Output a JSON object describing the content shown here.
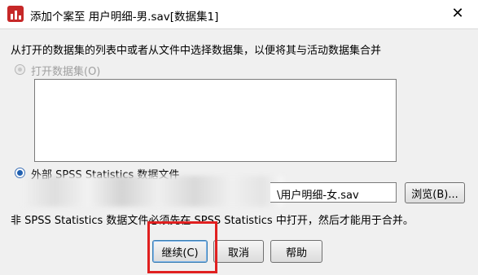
{
  "window": {
    "title": "添加个案至 用户明细-男.sav[数据集1]",
    "close_glyph": "✕",
    "app_icon": "spss-app-icon"
  },
  "intro": {
    "text": "从打开的数据集的列表中或者从文件中选择数据集，以便将其与活动数据集合并"
  },
  "open_datasets": {
    "label": "打开数据集(O)",
    "selected": false,
    "enabled": false,
    "items": []
  },
  "external_file": {
    "label": "外部 SPSS Statistics 数据文件",
    "selected": true,
    "path_value": "\\用户明细-女.sav",
    "browse_label": "浏览(B)..."
  },
  "note": {
    "text": "非 SPSS Statistics 数据文件必须先在 SPSS Statistics 中打开，然后才能用于合并。"
  },
  "buttons": {
    "continue_label": "继续(C)",
    "cancel_label": "取消",
    "help_label": "帮助"
  },
  "colors": {
    "highlight": "#e02020",
    "radio_selected": "#1f5fb0",
    "app_icon": "#c62828"
  }
}
